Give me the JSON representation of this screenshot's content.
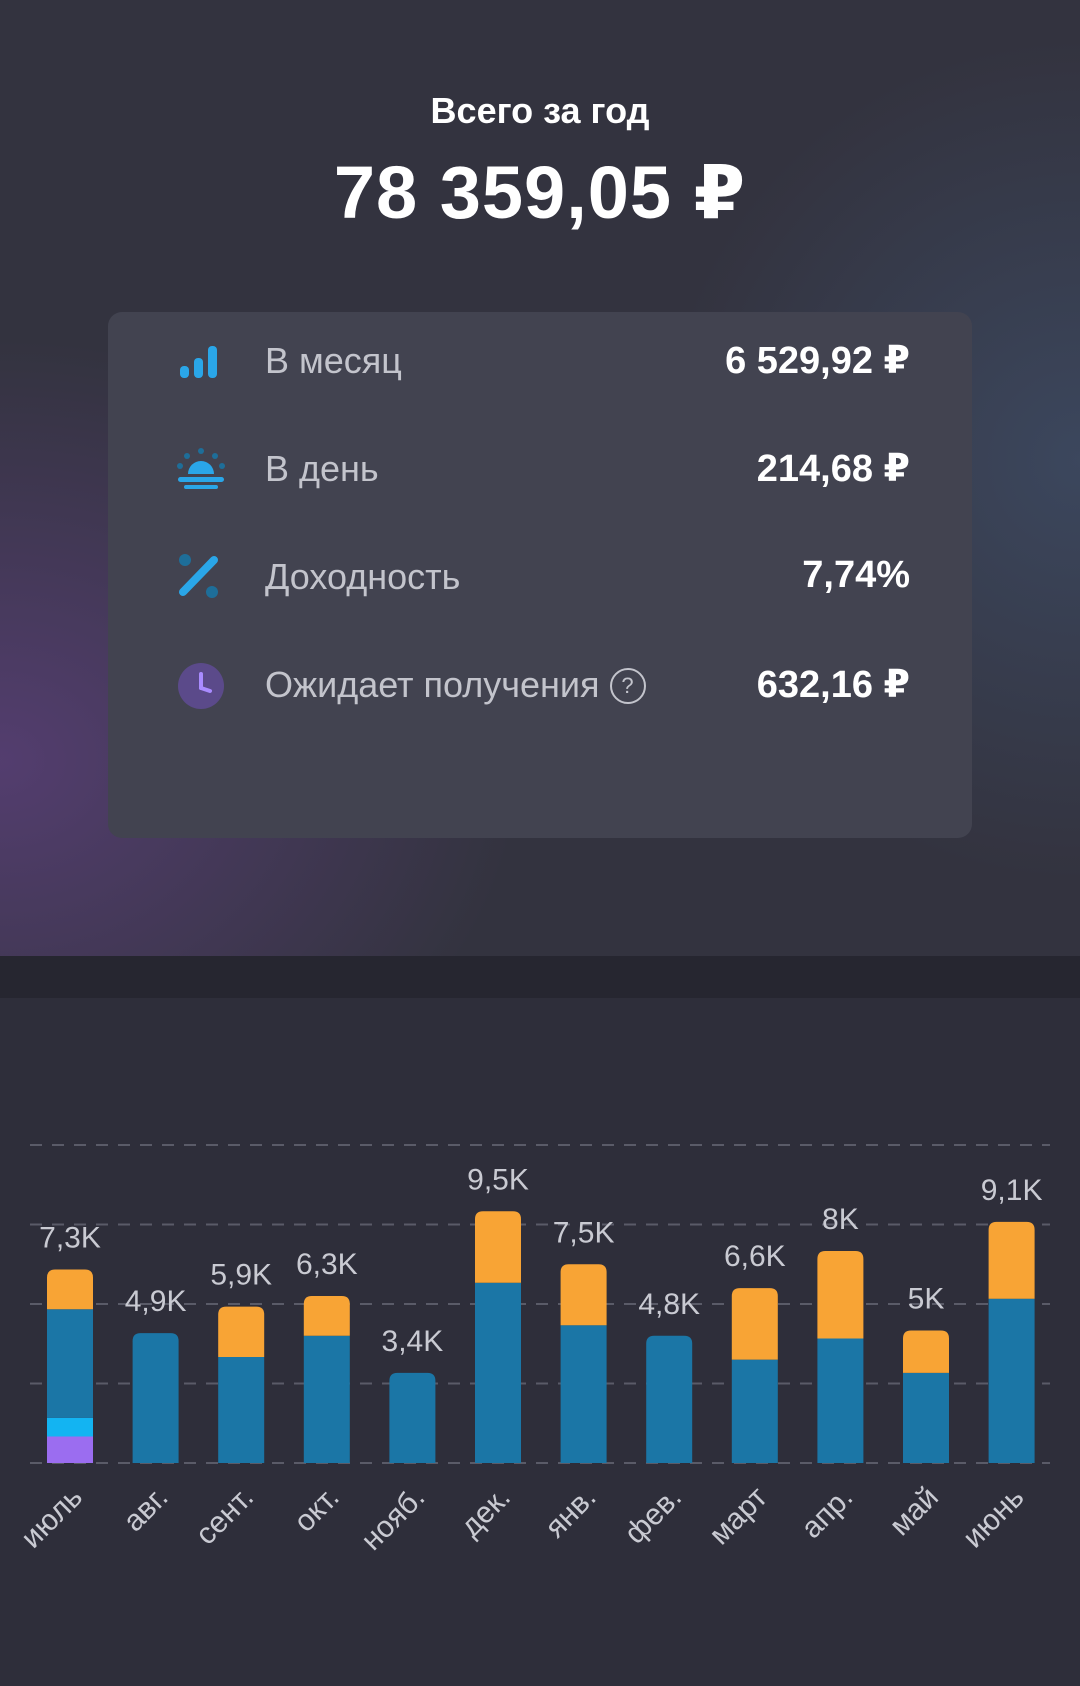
{
  "header": {
    "label": "Всего за год",
    "total": "78 359,05 ₽"
  },
  "stats": {
    "month": {
      "label": "В месяц",
      "value": "6 529,92 ₽",
      "icon": "bar-chart-icon"
    },
    "day": {
      "label": "В день",
      "value": "214,68 ₽",
      "icon": "sunrise-icon"
    },
    "yield": {
      "label": "Доходность",
      "value": "7,74%",
      "icon": "percent-icon"
    },
    "pending": {
      "label": "Ожидает получения",
      "value": "632,16 ₽",
      "icon": "clock-icon",
      "help": "?"
    }
  },
  "colors": {
    "blue": "#1b76a6",
    "orange": "#f8a435",
    "cyan": "#13b4f2",
    "purple": "#9b6df0",
    "accent_icon": "#2aa6e8"
  },
  "chart_data": {
    "type": "bar",
    "categories": [
      "июль",
      "авг.",
      "сент.",
      "окт.",
      "нояб.",
      "дек.",
      "янв.",
      "фев.",
      "март",
      "апр.",
      "май",
      "июнь"
    ],
    "totals_labels": [
      "7,3K",
      "4,9K",
      "5,9K",
      "6,3K",
      "3,4K",
      "9,5K",
      "7,5K",
      "4,8K",
      "6,6K",
      "8K",
      "5K",
      "9,1K"
    ],
    "series": [
      {
        "color": "#9b6df0",
        "values": [
          1.0,
          0,
          0,
          0,
          0,
          0,
          0,
          0,
          0,
          0,
          0,
          0
        ]
      },
      {
        "color": "#13b4f2",
        "values": [
          0.7,
          0,
          0,
          0,
          0,
          0,
          0,
          0,
          0,
          0,
          0,
          0
        ]
      },
      {
        "color": "#1b76a6",
        "values": [
          4.1,
          4.9,
          4.0,
          4.8,
          3.4,
          6.8,
          5.2,
          4.8,
          3.9,
          4.7,
          3.4,
          6.2
        ]
      },
      {
        "color": "#f8a435",
        "values": [
          1.5,
          0,
          1.9,
          1.5,
          0,
          2.7,
          2.3,
          0,
          2.7,
          3.3,
          1.6,
          2.9
        ]
      }
    ],
    "ylim": [
      0,
      12
    ],
    "grid": true,
    "gridlines": [
      3,
      6,
      9,
      12
    ]
  }
}
